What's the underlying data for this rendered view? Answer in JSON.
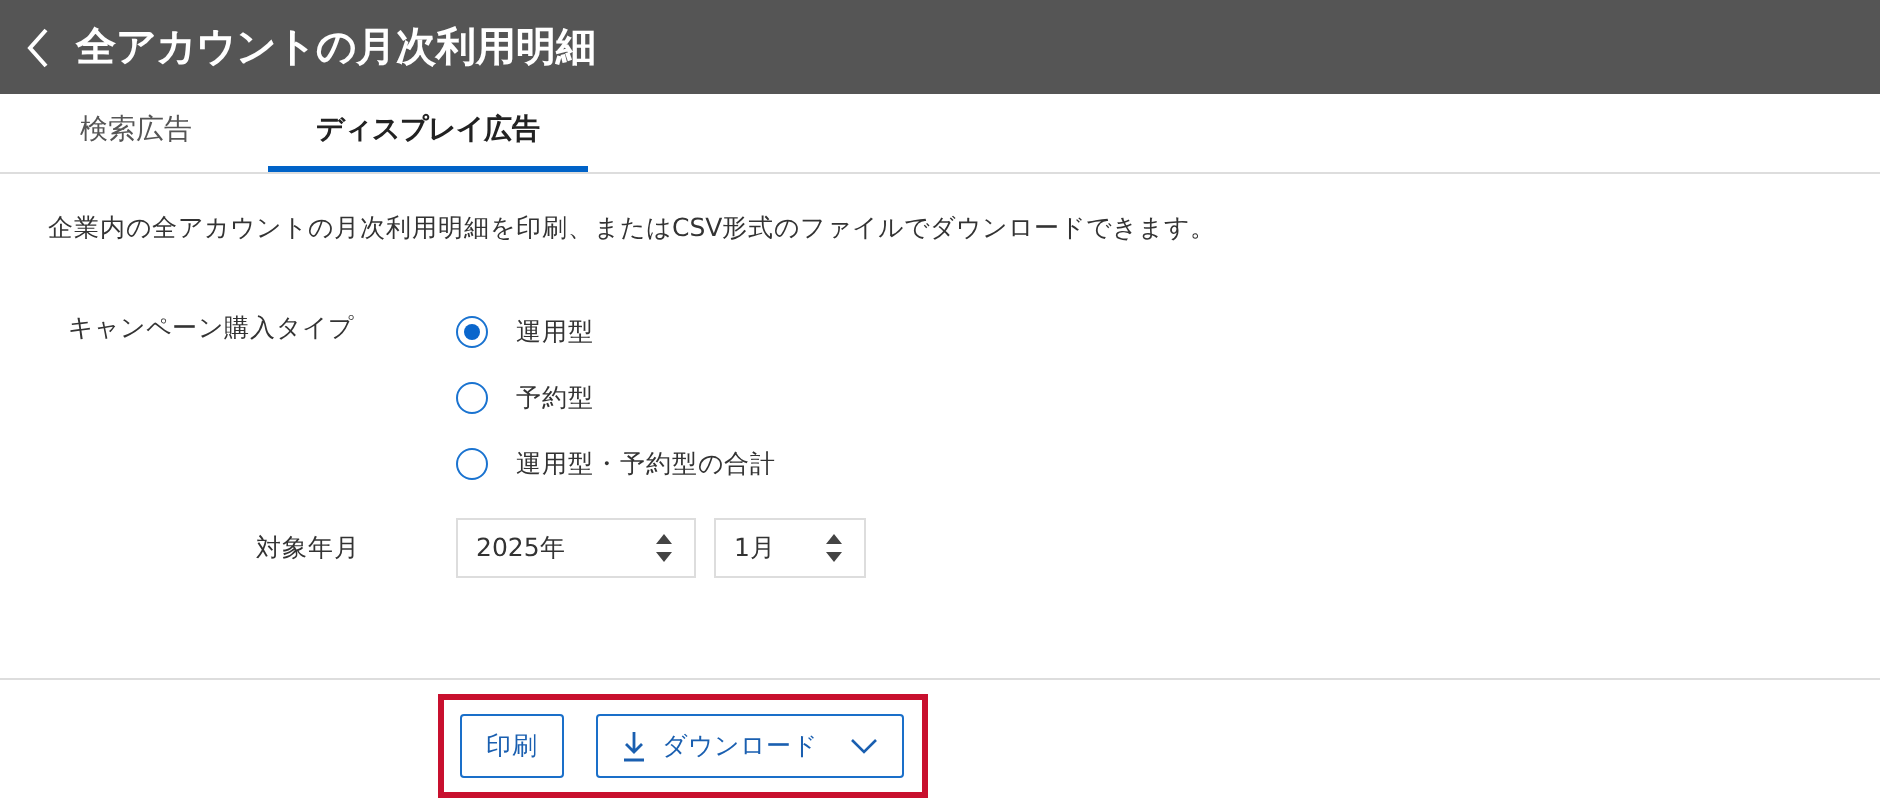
{
  "header": {
    "title": "全アカウントの月次利用明細"
  },
  "tabs": [
    {
      "label": "検索広告",
      "selected": false
    },
    {
      "label": "ディスプレイ広告",
      "selected": true
    }
  ],
  "description": "企業内の全アカウントの月次利用明細を印刷、またはCSV形式のファイルでダウンロードできます。",
  "campaign_type": {
    "label": "キャンペーン購入タイプ",
    "options": [
      {
        "label": "運用型",
        "selected": true
      },
      {
        "label": "予約型",
        "selected": false
      },
      {
        "label": "運用型・予約型の合計",
        "selected": false
      }
    ]
  },
  "target_month": {
    "label": "対象年月",
    "year": "2025年",
    "month": "1月"
  },
  "actions": {
    "highlighted": true,
    "buttons": [
      {
        "label": "印刷",
        "kind": "plain"
      },
      {
        "label": "ダウンロード",
        "kind": "download"
      }
    ]
  }
}
